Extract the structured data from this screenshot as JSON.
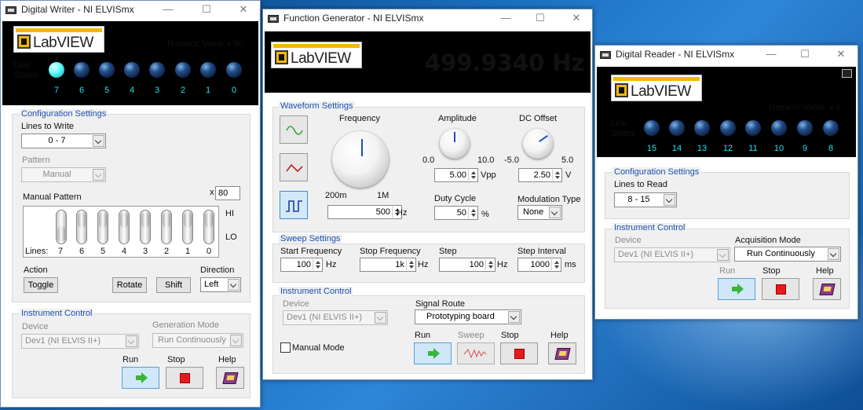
{
  "digital_writer": {
    "title": "Digital Writer - NI ELVISmx",
    "logo_text": "LabVIEW",
    "numeric_value_label": "Numeric Value",
    "numeric_value": "x 80",
    "line_states_label_1": "Line",
    "line_states_label_2": "States",
    "line_numbers": [
      "7",
      "6",
      "5",
      "4",
      "3",
      "2",
      "1",
      "0"
    ],
    "led_states": [
      true,
      false,
      false,
      false,
      false,
      false,
      false,
      false
    ],
    "config_title": "Configuration Settings",
    "lines_to_write_label": "Lines to Write",
    "lines_to_write": "0 - 7",
    "pattern_label": "Pattern",
    "pattern_value": "Manual",
    "manual_pattern_label": "Manual Pattern",
    "manual_pattern_value": "80",
    "manual_pattern_prefix": "x",
    "hi_label": "HI",
    "lo_label": "LO",
    "lines_label": "Lines:",
    "switch_numbers": [
      "7",
      "6",
      "5",
      "4",
      "3",
      "2",
      "1",
      "0"
    ],
    "switch_states": [
      "lo",
      "hi",
      "hi",
      "hi",
      "hi",
      "hi",
      "hi",
      "hi"
    ],
    "action_label": "Action",
    "toggle_label": "Toggle",
    "rotate_label": "Rotate",
    "shift_label": "Shift",
    "direction_label": "Direction",
    "direction_value": "Left",
    "instr_title": "Instrument Control",
    "device_label": "Device",
    "device_value": "Dev1 (NI ELVIS II+)",
    "gen_mode_label": "Generation Mode",
    "gen_mode_value": "Run Continuously",
    "run_label": "Run",
    "stop_label": "Stop",
    "help_label": "Help"
  },
  "function_generator": {
    "title": "Function Generator - NI ELVISmx",
    "logo_text": "LabVIEW",
    "freq_display": "499.9340 Hz",
    "waveform_title": "Waveform Settings",
    "frequency_label": "Frequency",
    "freq_min": "200m",
    "freq_max": "1M",
    "freq_value": "500",
    "freq_unit": "Hz",
    "amplitude_label": "Amplitude",
    "amp_min": "0.0",
    "amp_max": "10.0",
    "amp_value": "5.00",
    "amp_unit": "Vpp",
    "dc_offset_label": "DC Offset",
    "dc_min": "-5.0",
    "dc_max": "5.0",
    "dc_value": "2.50",
    "dc_unit": "V",
    "duty_label": "Duty Cycle",
    "duty_value": "50",
    "duty_unit": "%",
    "mod_label": "Modulation Type",
    "mod_value": "None",
    "sweep_title": "Sweep Settings",
    "start_freq_label": "Start Frequency",
    "start_freq_value": "100",
    "stop_freq_label": "Stop Frequency",
    "stop_freq_value": "1k",
    "step_label": "Step",
    "step_value": "100",
    "step_interval_label": "Step Interval",
    "step_interval_value": "1000",
    "hz": "Hz",
    "ms": "ms",
    "instr_title": "Instrument Control",
    "device_label": "Device",
    "device_value": "Dev1 (NI ELVIS II+)",
    "signal_route_label": "Signal Route",
    "signal_route_value": "Prototyping board",
    "manual_mode_label": "Manual Mode",
    "run_label": "Run",
    "sweep_label": "Sweep",
    "stop_label": "Stop",
    "help_label": "Help"
  },
  "digital_reader": {
    "title": "Digital Reader - NI ELVISmx",
    "logo_text": "LabVIEW",
    "numeric_value_label": "Numeric Value",
    "numeric_value": "x 0",
    "line_states_label_1": "Line",
    "line_states_label_2": "States",
    "line_numbers": [
      "15",
      "14",
      "13",
      "12",
      "11",
      "10",
      "9",
      "8"
    ],
    "config_title": "Configuration Settings",
    "lines_to_read_label": "Lines to Read",
    "lines_to_read": "8 - 15",
    "instr_title": "Instrument Control",
    "device_label": "Device",
    "device_value": "Dev1 (NI ELVIS II+)",
    "acq_mode_label": "Acquisition Mode",
    "acq_mode_value": "Run Continuously",
    "run_label": "Run",
    "stop_label": "Stop",
    "help_label": "Help"
  },
  "colors": {
    "accent_cyan": "#25e0ee",
    "section_blue": "#1c50b0",
    "stop_red": "#e51b1b",
    "run_green": "#3ab53a"
  }
}
